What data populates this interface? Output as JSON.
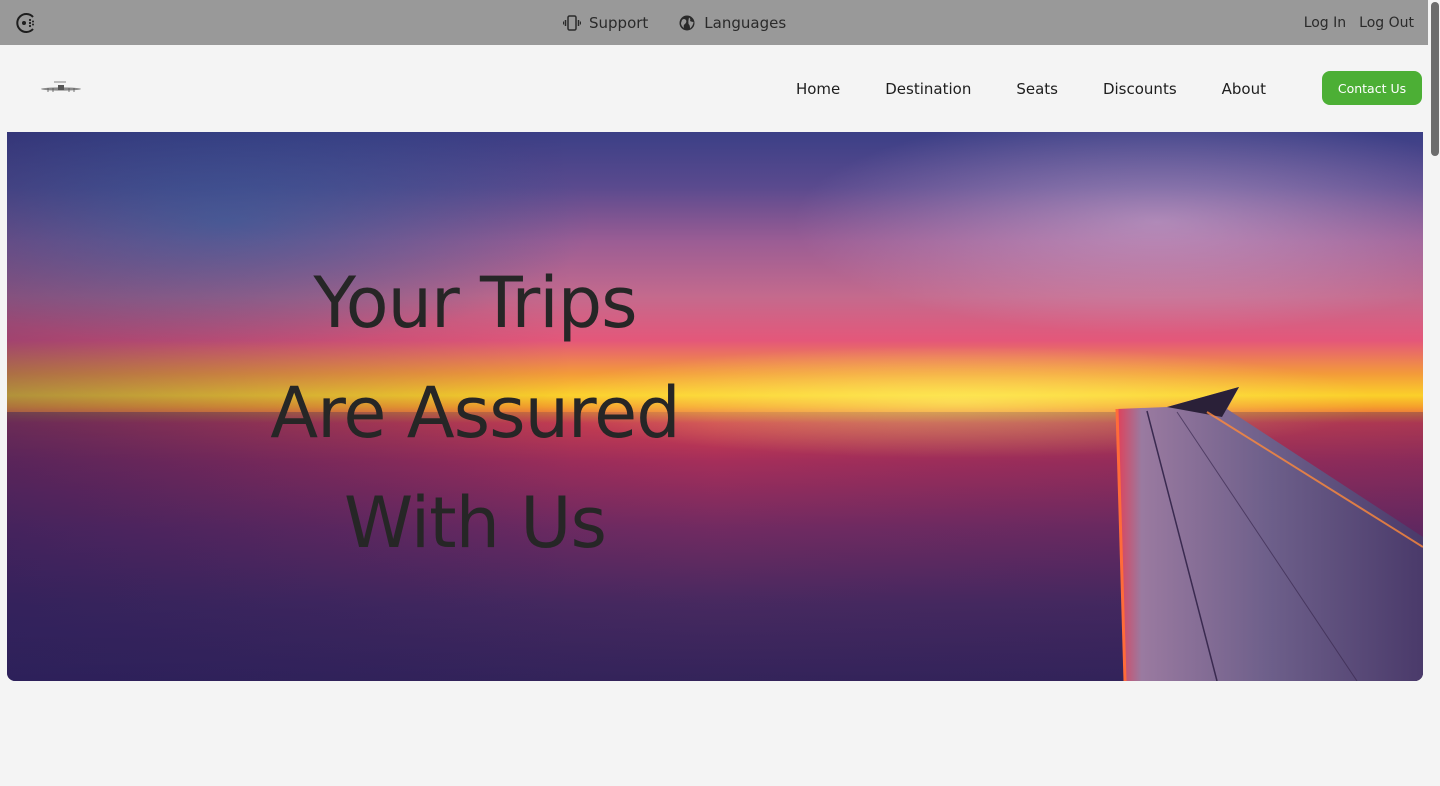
{
  "topbar": {
    "support_label": "Support",
    "languages_label": "Languages",
    "login_label": "Log In",
    "logout_label": "Log Out",
    "brand_icon": "spinner-dots-icon",
    "support_icon": "vibrating-phone-icon",
    "languages_icon": "globe-icon"
  },
  "navbar": {
    "logo": "airplane-logo",
    "items": [
      {
        "label": "Home"
      },
      {
        "label": "Destination"
      },
      {
        "label": "Seats"
      },
      {
        "label": "Discounts"
      },
      {
        "label": "About"
      }
    ],
    "contact_label": "Contact Us"
  },
  "hero": {
    "title_lines": [
      "Your Trips",
      "Are Assured",
      "With Us"
    ]
  },
  "colors": {
    "topbar_bg": "#999999",
    "page_bg": "#f4f4f4",
    "contact_button": "#4caf35",
    "hero_text": "#262626"
  }
}
